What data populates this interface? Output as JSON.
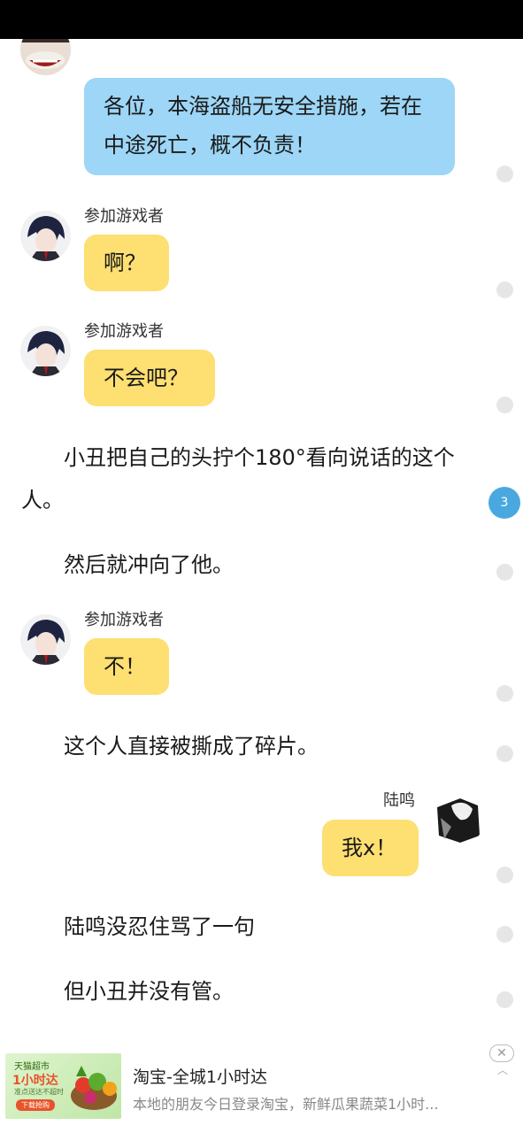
{
  "messages": [
    {
      "kind": "bubble",
      "sender": "",
      "text": "各位，本海盗船无安全措施，若在中途死亡，概不负责！",
      "color": "#9dd6f6"
    },
    {
      "kind": "bubble",
      "sender": "参加游戏者",
      "text": "啊？",
      "color": "#fddf72"
    },
    {
      "kind": "bubble",
      "sender": "参加游戏者",
      "text": "不会吧？",
      "color": "#fddf72"
    },
    {
      "kind": "narration",
      "text": "小丑把自己的头拧个180°看向说话的这个人。"
    },
    {
      "kind": "narration",
      "text": "然后就冲向了他。"
    },
    {
      "kind": "bubble",
      "sender": "参加游戏者",
      "text": "不！",
      "color": "#fddf72"
    },
    {
      "kind": "narration",
      "text": "这个人直接被撕成了碎片。"
    },
    {
      "kind": "bubble",
      "sender": "陆鸣",
      "text": "我x！",
      "color": "#fddf72"
    },
    {
      "kind": "narration",
      "text": "陆鸣没忍住骂了一句"
    },
    {
      "kind": "narration",
      "text": "但小丑并没有管。"
    }
  ],
  "comment_counts": {
    "highlighted": "3"
  },
  "ad": {
    "title": "淘宝-全城1小时达",
    "description": "本地的朋友今日登录淘宝，新鲜瓜果蔬菜1小时...",
    "thumb_brand": "天猫超市",
    "thumb_slogan": "1小时达",
    "thumb_sub": "准点送达不超时",
    "thumb_button": "下载抢购",
    "close_icon": "close-icon",
    "collapse_icon": "chevron-up-icon"
  },
  "colors": {
    "narrator_bubble": "#9dd6f6",
    "player_bubble": "#fddf72",
    "comment_count_badge": "#4aa8e0"
  }
}
